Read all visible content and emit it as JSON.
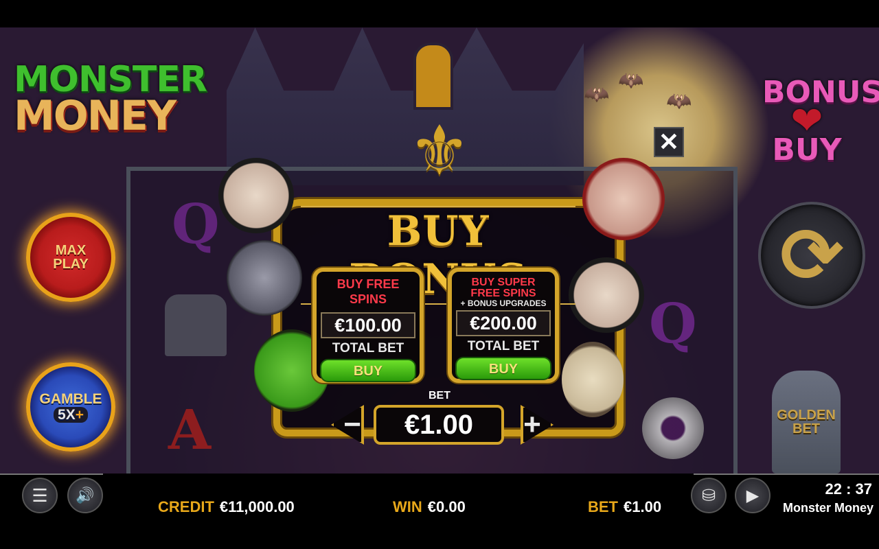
{
  "logo": {
    "line1": "MONSTER",
    "line2": "MONEY"
  },
  "bonus_buy_badge": {
    "line1": "BONUS",
    "heart_glyph": "❤",
    "line2": "BUY"
  },
  "side_buttons": {
    "max_play": {
      "line1": "MAX",
      "line2": "PLAY"
    },
    "gamble": {
      "line1": "GAMBLE",
      "multiplier": "5X",
      "plus_glyph": "+"
    },
    "spin_icon": "refresh-icon"
  },
  "golden_bet": {
    "line1": "GOLDEN",
    "line2": "BET"
  },
  "buy_bonus_modal": {
    "title": "BUY BONUS",
    "close_glyph": "✕",
    "offers": [
      {
        "name_line1": "BUY FREE",
        "name_line2": "SPINS",
        "subtitle": "",
        "price": "€100.00",
        "total_label": "TOTAL BET",
        "buy_label": "BUY"
      },
      {
        "name_line1": "BUY SUPER",
        "name_line2": "FREE SPINS",
        "subtitle": "+ BONUS UPGRADES",
        "price": "€200.00",
        "total_label": "TOTAL BET",
        "buy_label": "BUY"
      }
    ],
    "bet_label": "BET",
    "bet_value": "€1.00",
    "minus_glyph": "−",
    "plus_glyph": "+"
  },
  "bottom_bar": {
    "credit_label": "CREDIT",
    "credit_value": "€11,000.00",
    "win_label": "WIN",
    "win_value": "€0.00",
    "bet_label": "BET",
    "bet_value": "€1.00",
    "clock": "22 : 37",
    "game_name": "Monster Money",
    "menu_glyph": "☰",
    "sound_glyph": "🔊",
    "coins_glyph": "⛁",
    "autoplay_glyph": "▶"
  },
  "colors": {
    "gold": "#d4a52a",
    "offer_name_red": "#ff3a4a",
    "buy_green": "#3ab012",
    "label_orange": "#e8a81a"
  }
}
